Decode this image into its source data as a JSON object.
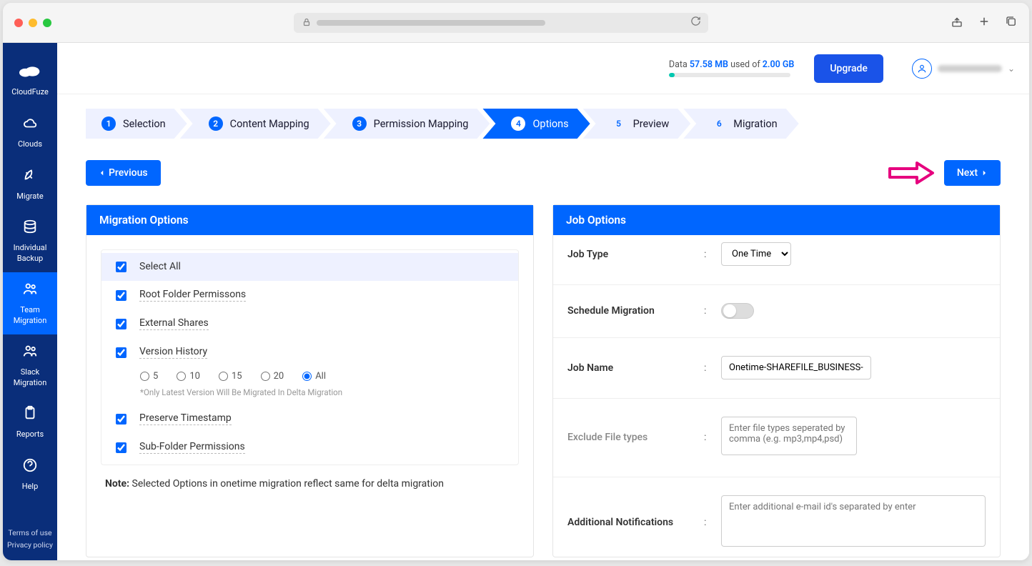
{
  "sidebar": {
    "brand": "CloudFuze",
    "items": [
      {
        "label": "Clouds"
      },
      {
        "label": "Migrate"
      },
      {
        "label": "Individual Backup"
      },
      {
        "label": "Team Migration"
      },
      {
        "label": "Slack Migration"
      },
      {
        "label": "Reports"
      },
      {
        "label": "Help"
      }
    ],
    "footer": {
      "terms": "Terms of use",
      "privacy": "Privacy policy"
    }
  },
  "topbar": {
    "usage_prefix": "Data ",
    "usage_amount": "57.58 MB",
    "usage_middle": " used of ",
    "usage_total": "2.00 GB",
    "upgrade": "Upgrade"
  },
  "stepper": [
    {
      "num": "1",
      "label": "Selection"
    },
    {
      "num": "2",
      "label": "Content Mapping"
    },
    {
      "num": "3",
      "label": "Permission Mapping"
    },
    {
      "num": "4",
      "label": "Options"
    },
    {
      "num": "5",
      "label": "Preview"
    },
    {
      "num": "6",
      "label": "Migration"
    }
  ],
  "nav": {
    "previous": "Previous",
    "next": "Next"
  },
  "migration_options": {
    "title": "Migration Options",
    "select_all": "Select All",
    "items": [
      {
        "label": "Root Folder Permissons"
      },
      {
        "label": "External Shares"
      },
      {
        "label": "Version History"
      },
      {
        "label": "Preserve Timestamp"
      },
      {
        "label": "Sub-Folder Permissions"
      }
    ],
    "version_radios": [
      "5",
      "10",
      "15",
      "20",
      "All"
    ],
    "version_note": "*Only Latest Version Will Be Migrated In Delta Migration",
    "note_bold": "Note:",
    "note_text": " Selected Options in onetime migration reflect same for delta migration"
  },
  "job_options": {
    "title": "Job Options",
    "fields": {
      "job_type": "Job Type",
      "job_type_value": "One Time",
      "schedule": "Schedule Migration",
      "job_name": "Job Name",
      "job_name_value": "Onetime-SHAREFILE_BUSINESS-GSU",
      "exclude": "Exclude File types",
      "exclude_placeholder": "Enter file types seperated by comma (e.g. mp3,mp4,psd)",
      "notifications": "Additional Notifications",
      "notifications_placeholder": "Enter additional e-mail id's separated by enter"
    }
  }
}
